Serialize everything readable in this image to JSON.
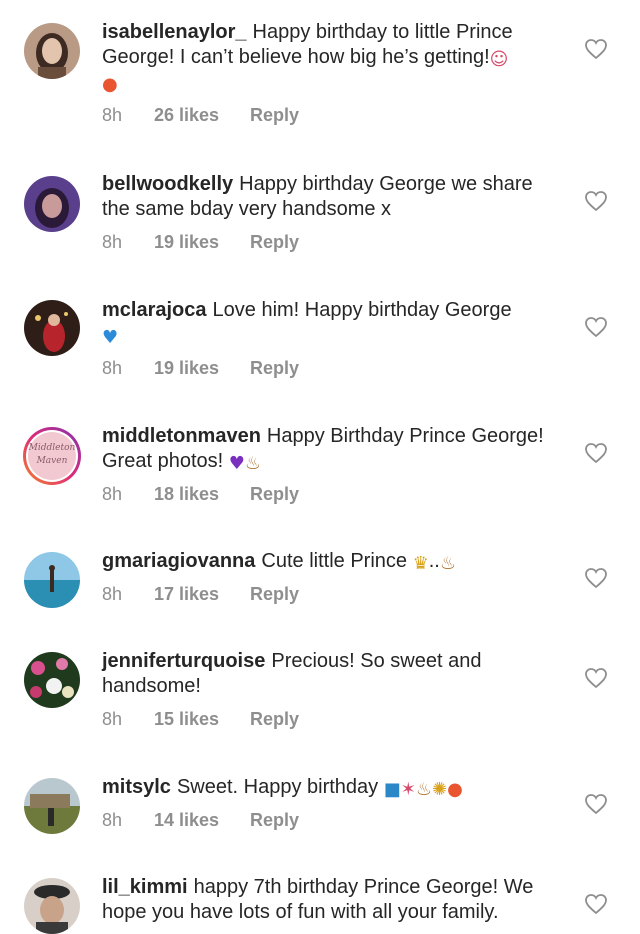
{
  "comments": [
    {
      "username": "isabellenaylor_",
      "text": "Happy birthday to little Prince George! I can’t believe how big he’s getting!",
      "emoji": [
        "smiling-face-with-hearts",
        "balloon"
      ],
      "time": "8h",
      "likes": "26 likes",
      "reply": "Reply"
    },
    {
      "username": "bellwoodkelly",
      "text": "Happy birthday George we share the same bday very handsome x",
      "emoji": [],
      "time": "8h",
      "likes": "19 likes",
      "reply": "Reply"
    },
    {
      "username": "mclarajoca",
      "text": "Love him! Happy birthday George",
      "emoji": [
        "blue-heart"
      ],
      "time": "8h",
      "likes": "19 likes",
      "reply": "Reply"
    },
    {
      "username": "middletonmaven",
      "text": "Happy Birthday Prince George! Great photos!",
      "emoji": [
        "purple-heart",
        "birthday-cake"
      ],
      "time": "8h",
      "likes": "18 likes",
      "reply": "Reply",
      "avatar_text_1": "Middleton",
      "avatar_text_2": "Maven"
    },
    {
      "username": "gmariagiovanna",
      "text": "Cute little Prince",
      "text_suffix": "..",
      "emoji": [
        "crown",
        "birthday-cake"
      ],
      "time": "8h",
      "likes": "17 likes",
      "reply": "Reply"
    },
    {
      "username": "jenniferturquoise",
      "text": "Precious! So sweet and handsome!",
      "emoji": [],
      "time": "8h",
      "likes": "15 likes",
      "reply": "Reply"
    },
    {
      "username": "mitsylc",
      "text": "Sweet.  Happy birthday",
      "emoji": [
        "wrapped-gift",
        "party-popper",
        "birthday-cake",
        "confetti-ball",
        "balloon"
      ],
      "time": "8h",
      "likes": "14 likes",
      "reply": "Reply"
    },
    {
      "username": "lil_kimmi",
      "text": "happy 7th birthday Prince George! We hope you have lots of fun with all your family.",
      "emoji": [],
      "time": "",
      "likes": "",
      "reply": ""
    }
  ],
  "colors": {
    "text": "#262626",
    "meta": "#8e8e8e",
    "heart_outline": "#8e8e8e",
    "background": "#ffffff",
    "story_ring": "#c13584"
  },
  "icons": {
    "like": "heart-outline-icon"
  }
}
